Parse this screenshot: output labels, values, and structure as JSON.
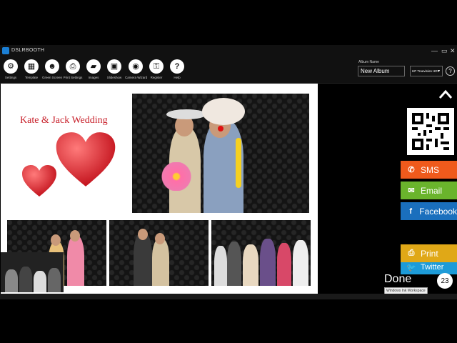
{
  "app": {
    "title": "DSLRBOOTH"
  },
  "toolbar": {
    "items": [
      {
        "label": "Settings",
        "icon": "gear-icon"
      },
      {
        "label": "Template",
        "icon": "template-icon"
      },
      {
        "label": "Green Screen",
        "icon": "green-screen-icon"
      },
      {
        "label": "Print Settings",
        "icon": "printer-icon"
      },
      {
        "label": "Images",
        "icon": "folder-icon"
      },
      {
        "label": "Slideshow",
        "icon": "slideshow-icon"
      },
      {
        "label": "Camera Wizard",
        "icon": "camera-icon"
      },
      {
        "label": "Register",
        "icon": "unlock-icon"
      },
      {
        "label": "Help",
        "icon": "help-icon"
      }
    ]
  },
  "album": {
    "label": "Album Name",
    "value": "New Album"
  },
  "printer": {
    "selected": "HP Truevision HD"
  },
  "help": {
    "symbol": "?"
  },
  "canvas": {
    "title": "Kate & Jack Wedding"
  },
  "share": {
    "sms": "SMS",
    "email": "Email",
    "facebook": "Facebook",
    "twitter": "Twitter",
    "print": "Print"
  },
  "done": {
    "label": "Done",
    "count": "23"
  },
  "tooltip": "Windows Ink Workspace",
  "colors": {
    "sms": "#ef5a1c",
    "email": "#6ab42c",
    "facebook": "#1a6fbd",
    "twitter": "#1d9bd8",
    "print": "#e0a817",
    "heart": "#d8202a"
  }
}
